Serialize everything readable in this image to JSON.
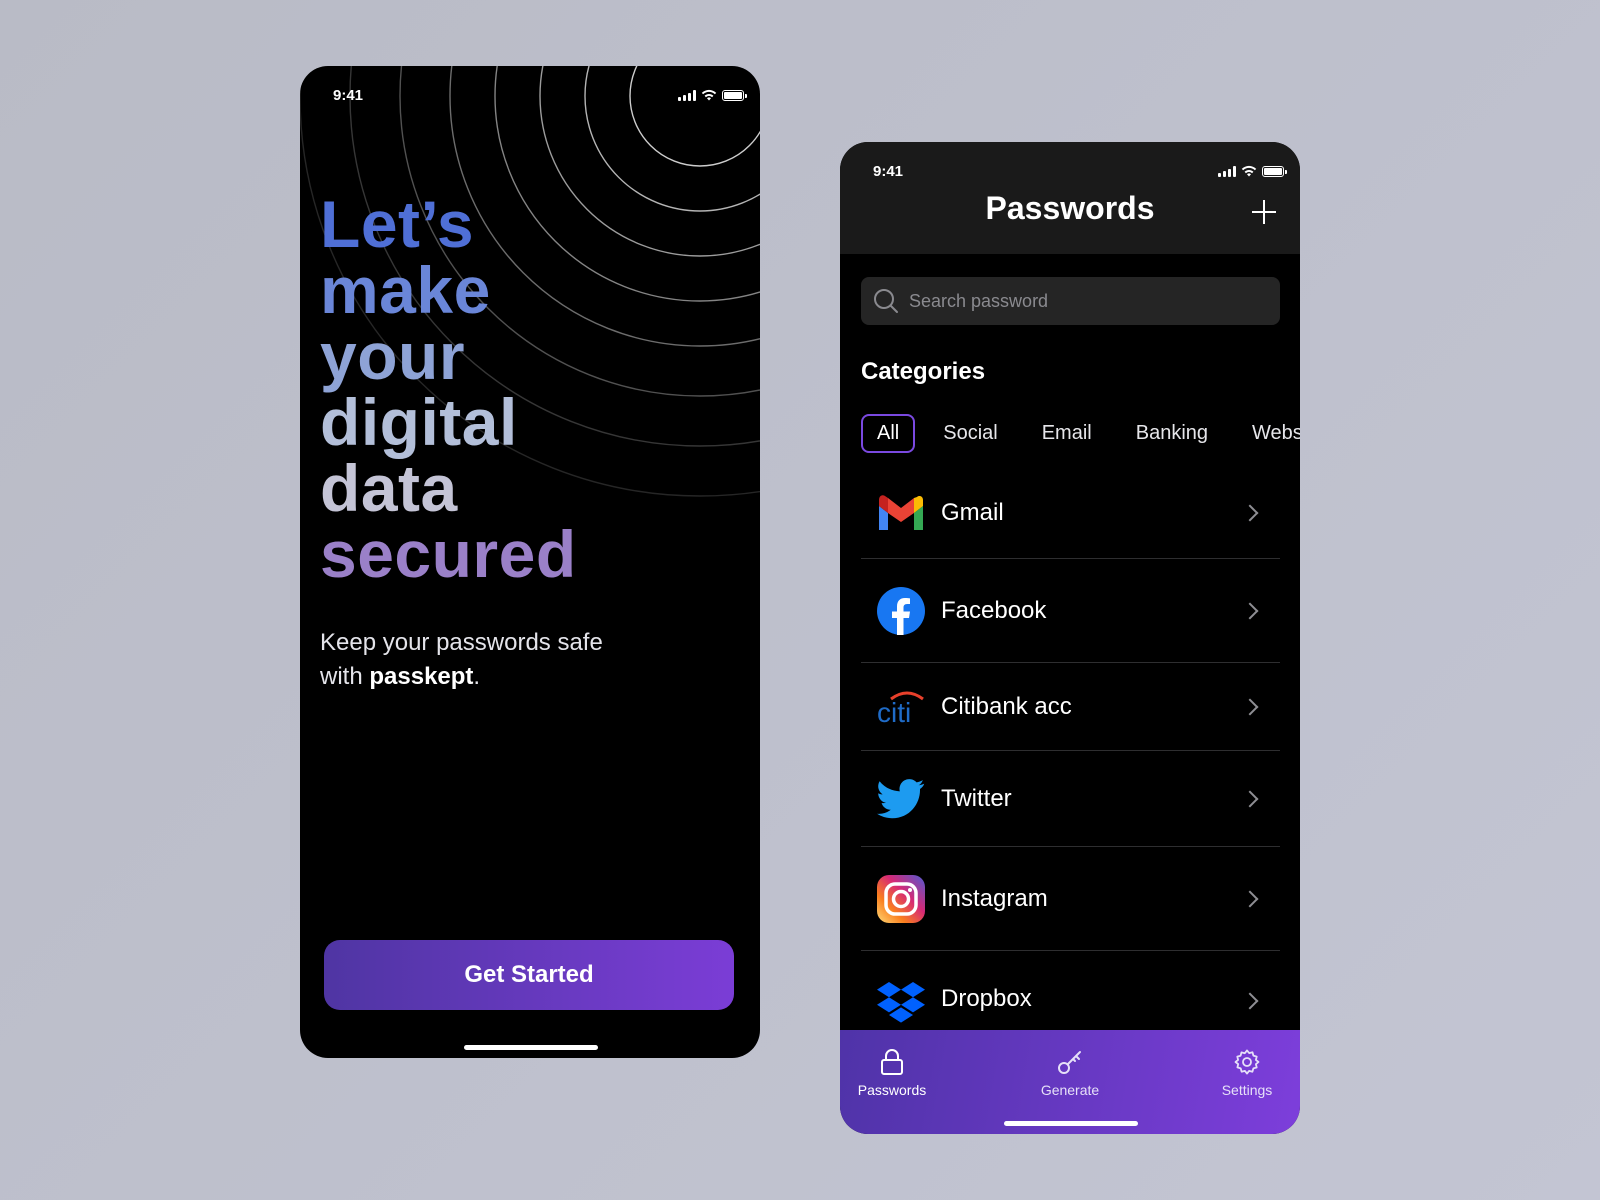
{
  "onboarding": {
    "status_time": "9:41",
    "headline": [
      "Let’s",
      "make",
      "your",
      "digital",
      "data",
      "secured"
    ],
    "subtitle_line1": "Keep your passwords safe",
    "subtitle_with": "with ",
    "subtitle_brand": "passkept",
    "subtitle_end": ".",
    "cta_label": "Get Started"
  },
  "passwords": {
    "status_time": "9:41",
    "title": "Passwords",
    "search_placeholder": "Search password",
    "categories_title": "Categories",
    "categories": [
      "All",
      "Social",
      "Email",
      "Banking",
      "Websit"
    ],
    "active_category": "All",
    "items": [
      {
        "name": "Gmail",
        "icon": "gmail-icon"
      },
      {
        "name": "Facebook",
        "icon": "facebook-icon"
      },
      {
        "name": "Citibank acc",
        "icon": "citi-icon"
      },
      {
        "name": "Twitter",
        "icon": "twitter-icon"
      },
      {
        "name": "Instagram",
        "icon": "instagram-icon"
      },
      {
        "name": "Dropbox",
        "icon": "dropbox-icon"
      }
    ],
    "tabs": [
      {
        "label": "Passwords",
        "icon": "lock-icon"
      },
      {
        "label": "Generate",
        "icon": "key-icon"
      },
      {
        "label": "Settings",
        "icon": "gear-icon"
      }
    ]
  },
  "colors": {
    "accent_purple": "#7b3dd6",
    "button_start": "#4f35a3",
    "chip_border": "#7a49e0",
    "background": "#000000"
  }
}
